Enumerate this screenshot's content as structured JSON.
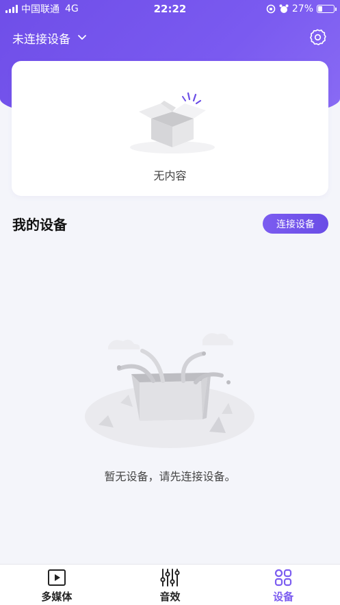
{
  "status_bar": {
    "carrier": "中国联通",
    "network": "4G",
    "time": "22:22",
    "battery": "27%",
    "battery_level": 0.27
  },
  "header": {
    "device_select_label": "未连接设备",
    "chevron_icon": "chevron-down-icon",
    "settings_icon": "gear-icon"
  },
  "content_card": {
    "empty_text": "无内容"
  },
  "devices": {
    "section_title": "我的设备",
    "connect_button": "连接设备",
    "empty_text": "暂无设备，请先连接设备。"
  },
  "tab_bar": {
    "tabs": [
      {
        "label": "多媒体",
        "icon": "play-icon",
        "active": false
      },
      {
        "label": "音效",
        "icon": "equalizer-icon",
        "active": false
      },
      {
        "label": "设备",
        "icon": "devices-icon",
        "active": true
      }
    ]
  },
  "colors": {
    "accent": "#7b5cf0",
    "header_bg": "#7356ec",
    "background": "#f4f5fa"
  }
}
